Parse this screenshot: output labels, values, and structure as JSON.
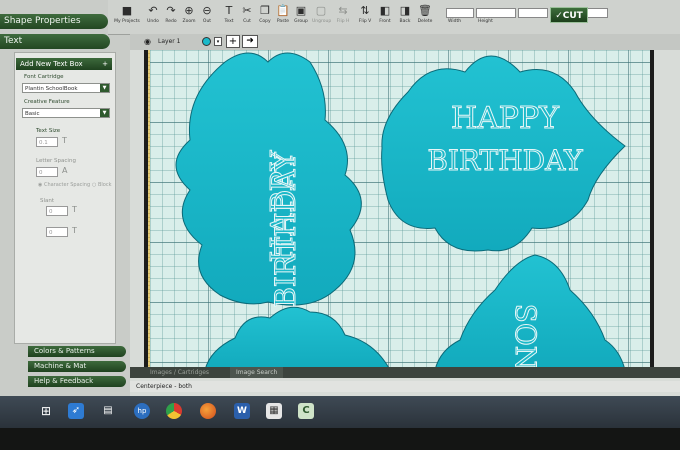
{
  "sidebar": {
    "shape_properties": "Shape Properties",
    "text": "Text",
    "add_text_box": "Add New Text Box",
    "font_cartridge_label": "Font Cartridge",
    "font_cartridge_value": "Plantin SchoolBook",
    "creative_feature_label": "Creative Feature",
    "creative_feature_value": "Basic",
    "text_size_label": "Text Size",
    "text_size_value": "0.1",
    "letter_spacing_label": "Letter Spacing",
    "letter_spacing_value": "0",
    "character_spacing": "Character Spacing",
    "block": "Block",
    "slant_label": "Slant",
    "slant_value": "0",
    "rotate_value": "0",
    "colors_patterns": "Colors & Patterns",
    "machine_mat": "Machine & Mat",
    "help_feedback": "Help & Feedback"
  },
  "toolbar": {
    "my_projects": "My Projects",
    "undo": "Undo",
    "redo": "Redo",
    "zoom_in": "Zoom",
    "zoom_out": "Out",
    "text": "Text",
    "cut": "Cut",
    "copy": "Copy",
    "paste": "Paste",
    "group": "Group",
    "ungroup": "Ungroup",
    "flip_h": "Flip H",
    "flip_v": "Flip V",
    "front": "Front",
    "back": "Back",
    "delete": "Delete",
    "width": "Width",
    "height": "Height",
    "cut_button": "CUT"
  },
  "layer": {
    "name": "Layer 1"
  },
  "canvas": {
    "shape1_line1": "HAPPY",
    "shape1_line2": "BIRTHDAY",
    "shape2_line1": "HAPPY",
    "shape2_line2": "BIRTHDAY",
    "shape3_text": "SON"
  },
  "bottom_tabs": {
    "images_cartridges": "Images / Cartridges",
    "image_search": "Image Search"
  },
  "status": {
    "project_name": "Centerpiece - both"
  },
  "colors": {
    "shape_fill": "#1bb9c9",
    "shape_stroke": "#0b6a78",
    "accent_green": "#2f5a2e"
  }
}
